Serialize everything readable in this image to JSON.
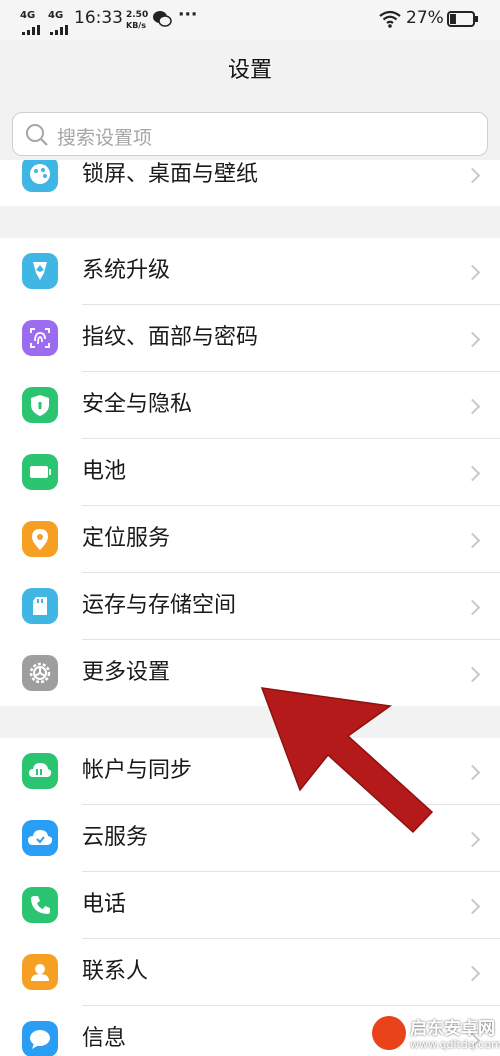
{
  "status_bar": {
    "net1": "4G",
    "net2": "4G",
    "time": "16:33",
    "speed_value": "2.50",
    "speed_unit": "KB/s",
    "more": "···",
    "battery": "27%",
    "battery_level": 0.27
  },
  "header": {
    "title": "设置"
  },
  "search": {
    "placeholder": "搜索设置项"
  },
  "top_item": {
    "label": "锁屏、桌面与壁纸"
  },
  "group1": [
    {
      "label": "系统升级",
      "icon": "system-update-icon",
      "color": "#3fb6e4"
    },
    {
      "label": "指纹、面部与密码",
      "icon": "fingerprint-icon",
      "color": "#9b6cf0"
    },
    {
      "label": "安全与隐私",
      "icon": "shield-icon",
      "color": "#2bc470"
    },
    {
      "label": "电池",
      "icon": "battery-icon",
      "color": "#2bc470"
    },
    {
      "label": "定位服务",
      "icon": "location-pin-icon",
      "color": "#f5a023"
    },
    {
      "label": "运存与存储空间",
      "icon": "sd-card-icon",
      "color": "#3fb6e4"
    },
    {
      "label": "更多设置",
      "icon": "gear-icon",
      "color": "#9e9e9e"
    }
  ],
  "group2": [
    {
      "label": "帐户与同步",
      "icon": "account-sync-icon",
      "color": "#2bc470"
    },
    {
      "label": "云服务",
      "icon": "cloud-icon",
      "color": "#2a9df4"
    },
    {
      "label": "电话",
      "icon": "phone-icon",
      "color": "#2bc470"
    },
    {
      "label": "联系人",
      "icon": "contact-icon",
      "color": "#f5a023"
    },
    {
      "label": "信息",
      "icon": "message-icon",
      "color": "#2a9df4"
    }
  ],
  "watermark": {
    "title": "启东安卓网",
    "url": "www.qdltdq.com"
  }
}
